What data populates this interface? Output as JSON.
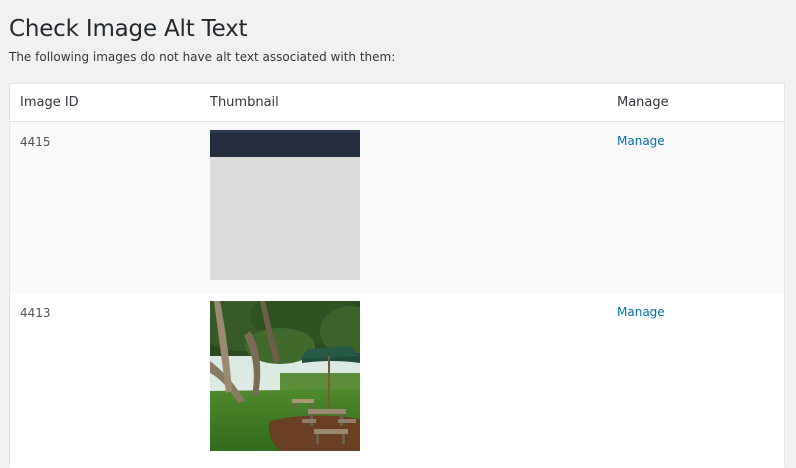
{
  "page": {
    "title": "Check Image Alt Text",
    "description": "The following images do not have alt text associated with them:"
  },
  "table": {
    "columns": [
      "Image ID",
      "Thumbnail",
      "Manage"
    ],
    "rows": [
      {
        "id": "4415",
        "thumbnail": "placeholder-screenshot-thumbnail",
        "action": "Manage"
      },
      {
        "id": "4413",
        "thumbnail": "park-trees-umbrella-picnic-tables-photo",
        "action": "Manage"
      }
    ]
  }
}
